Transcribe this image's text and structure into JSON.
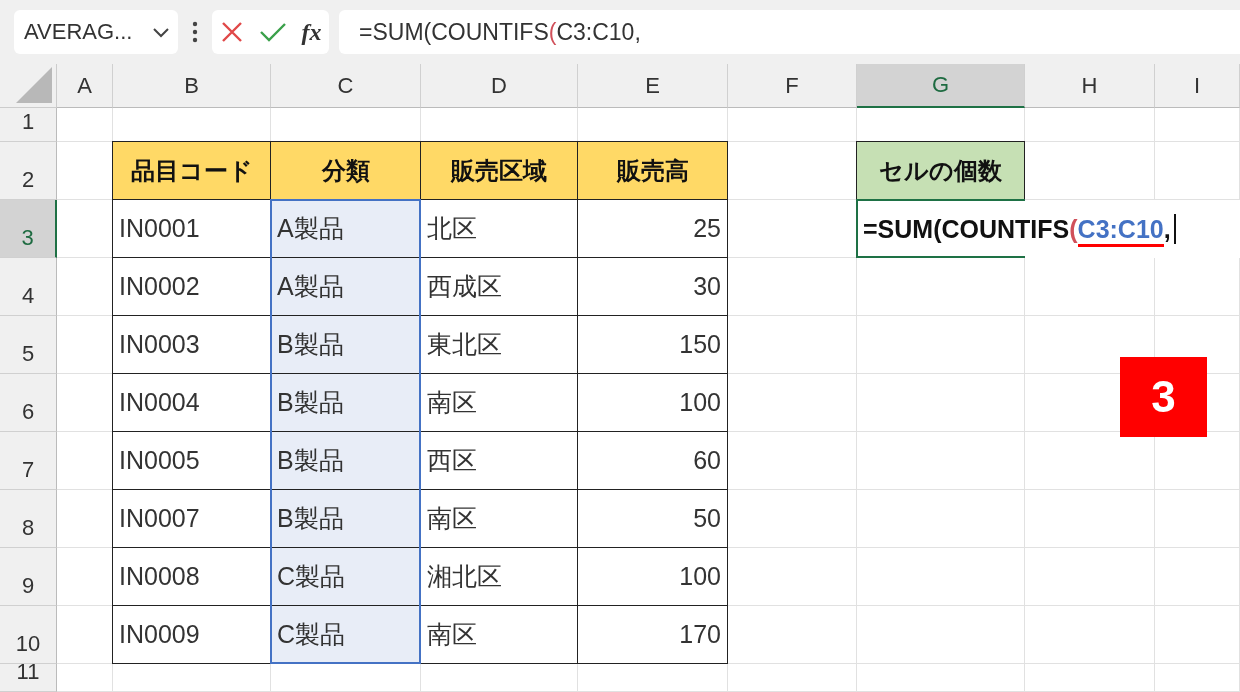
{
  "name_box": {
    "value": "AVERAG..."
  },
  "formula_bar": {
    "function_label": "fx",
    "parts": [
      {
        "kind": "plain",
        "text": "=SUM(COUNTIFS"
      },
      {
        "kind": "paren",
        "text": "("
      },
      {
        "kind": "plain",
        "text": "C3:C10,"
      }
    ]
  },
  "columns": [
    {
      "label": "A",
      "selected": false
    },
    {
      "label": "B",
      "selected": false
    },
    {
      "label": "C",
      "selected": false
    },
    {
      "label": "D",
      "selected": false
    },
    {
      "label": "E",
      "selected": false
    },
    {
      "label": "F",
      "selected": false
    },
    {
      "label": "G",
      "selected": true
    },
    {
      "label": "H",
      "selected": false
    },
    {
      "label": "I",
      "selected": false
    }
  ],
  "rows": [
    {
      "label": "1",
      "selected": false
    },
    {
      "label": "2",
      "selected": false
    },
    {
      "label": "3",
      "selected": true
    },
    {
      "label": "4",
      "selected": false
    },
    {
      "label": "5",
      "selected": false
    },
    {
      "label": "6",
      "selected": false
    },
    {
      "label": "7",
      "selected": false
    },
    {
      "label": "8",
      "selected": false
    },
    {
      "label": "9",
      "selected": false
    },
    {
      "label": "10",
      "selected": false
    },
    {
      "label": "11",
      "selected": false
    }
  ],
  "table": {
    "columns": [
      {
        "label": "品目コード",
        "highlighted": false,
        "kind": "text"
      },
      {
        "label": "分類",
        "highlighted": true,
        "kind": "text"
      },
      {
        "label": "販売区域",
        "highlighted": false,
        "kind": "text"
      },
      {
        "label": "販売高",
        "highlighted": false,
        "kind": "number"
      }
    ],
    "rows": [
      [
        "IN0001",
        "A製品",
        "北区",
        "25"
      ],
      [
        "IN0002",
        "A製品",
        "西成区",
        "30"
      ],
      [
        "IN0003",
        "B製品",
        "東北区",
        "150"
      ],
      [
        "IN0004",
        "B製品",
        "南区",
        "100"
      ],
      [
        "IN0005",
        "B製品",
        "西区",
        "60"
      ],
      [
        "IN0007",
        "B製品",
        "南区",
        "50"
      ],
      [
        "IN0008",
        "C製品",
        "湘北区",
        "100"
      ],
      [
        "IN0009",
        "C製品",
        "南区",
        "170"
      ]
    ]
  },
  "result": {
    "header": "セルの個数",
    "parts": [
      {
        "kind": "plain",
        "text": "=SUM(COUNTIFS"
      },
      {
        "kind": "paren",
        "text": "("
      },
      {
        "kind": "ref",
        "text": "C3:C10",
        "underlined": true
      },
      {
        "kind": "plain",
        "text": ","
      }
    ]
  },
  "badge": {
    "text": "3"
  }
}
